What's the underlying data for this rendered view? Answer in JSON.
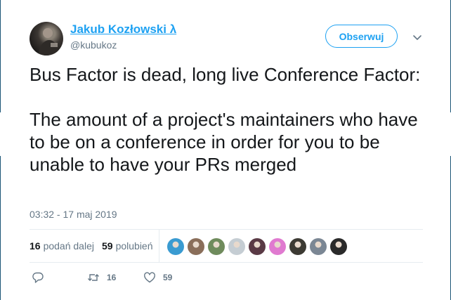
{
  "author": {
    "name": "Jakub Kozłowski λ",
    "handle": "@kubukoz"
  },
  "follow_label": "Obserwuj",
  "tweet": {
    "text": "Bus Factor is dead, long live Conference Factor:\n\nThe amount of a project's maintainers who have to be on a conference in order for you to be unable to have your PRs merged",
    "timestamp": "03:32 - 17 maj 2019"
  },
  "stats": {
    "retweets_count": "16",
    "retweets_label": "podań dalej",
    "likes_count": "59",
    "likes_label": "polubień"
  },
  "likers": [
    {
      "icon": "avatar-blue-face",
      "color": "#3a9bd1"
    },
    {
      "icon": "avatar-bearded",
      "color": "#8a6e5a"
    },
    {
      "icon": "avatar-outdoor",
      "color": "#6f8b5c"
    },
    {
      "icon": "avatar-default",
      "color": "#c5cdd3"
    },
    {
      "icon": "avatar-dark-pink",
      "color": "#5a3a45"
    },
    {
      "icon": "avatar-pink-sparkle",
      "color": "#e07ad0"
    },
    {
      "icon": "avatar-dark",
      "color": "#3c3a33"
    },
    {
      "icon": "avatar-grey-person",
      "color": "#7b8794"
    },
    {
      "icon": "avatar-black",
      "color": "#2a2a2a"
    }
  ],
  "actions": {
    "reply_icon": "reply-icon",
    "retweet_icon": "retweet-icon",
    "retweet_count": "16",
    "like_icon": "heart-icon",
    "like_count": "59"
  },
  "colors": {
    "accent": "#1da1f2",
    "text": "#14171a",
    "muted": "#657786"
  }
}
